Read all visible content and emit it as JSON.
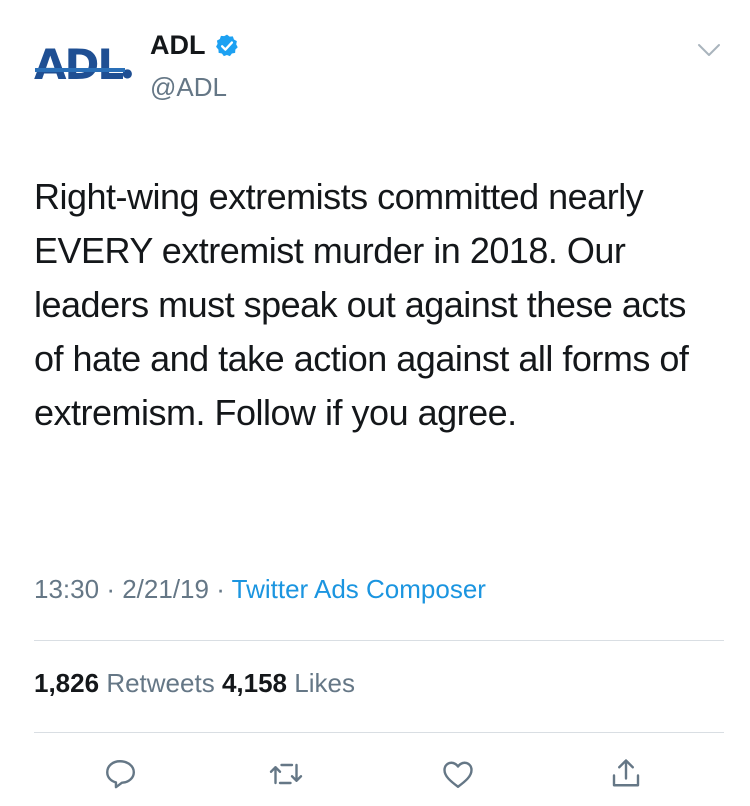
{
  "account": {
    "logo_text": "ADL",
    "name": "ADL",
    "handle": "@ADL",
    "verified": true,
    "brand_color": "#1f4f93"
  },
  "tweet": {
    "text": "Right-wing extremists committed nearly EVERY extremist murder in 2018. Our leaders must speak out against these acts of hate and take action against all forms of extremism. Follow if you agree.",
    "time": "13:30",
    "date": "2/21/19",
    "separator": "·",
    "source": "Twitter Ads Composer",
    "source_color": "#1b95e0"
  },
  "stats": {
    "retweets_count": "1,826",
    "retweets_label": "Retweets",
    "likes_count": "4,158",
    "likes_label": "Likes"
  },
  "actions": {
    "icons": [
      "reply-icon",
      "retweet-icon",
      "like-icon",
      "share-icon"
    ],
    "icon_color": "#657786"
  }
}
